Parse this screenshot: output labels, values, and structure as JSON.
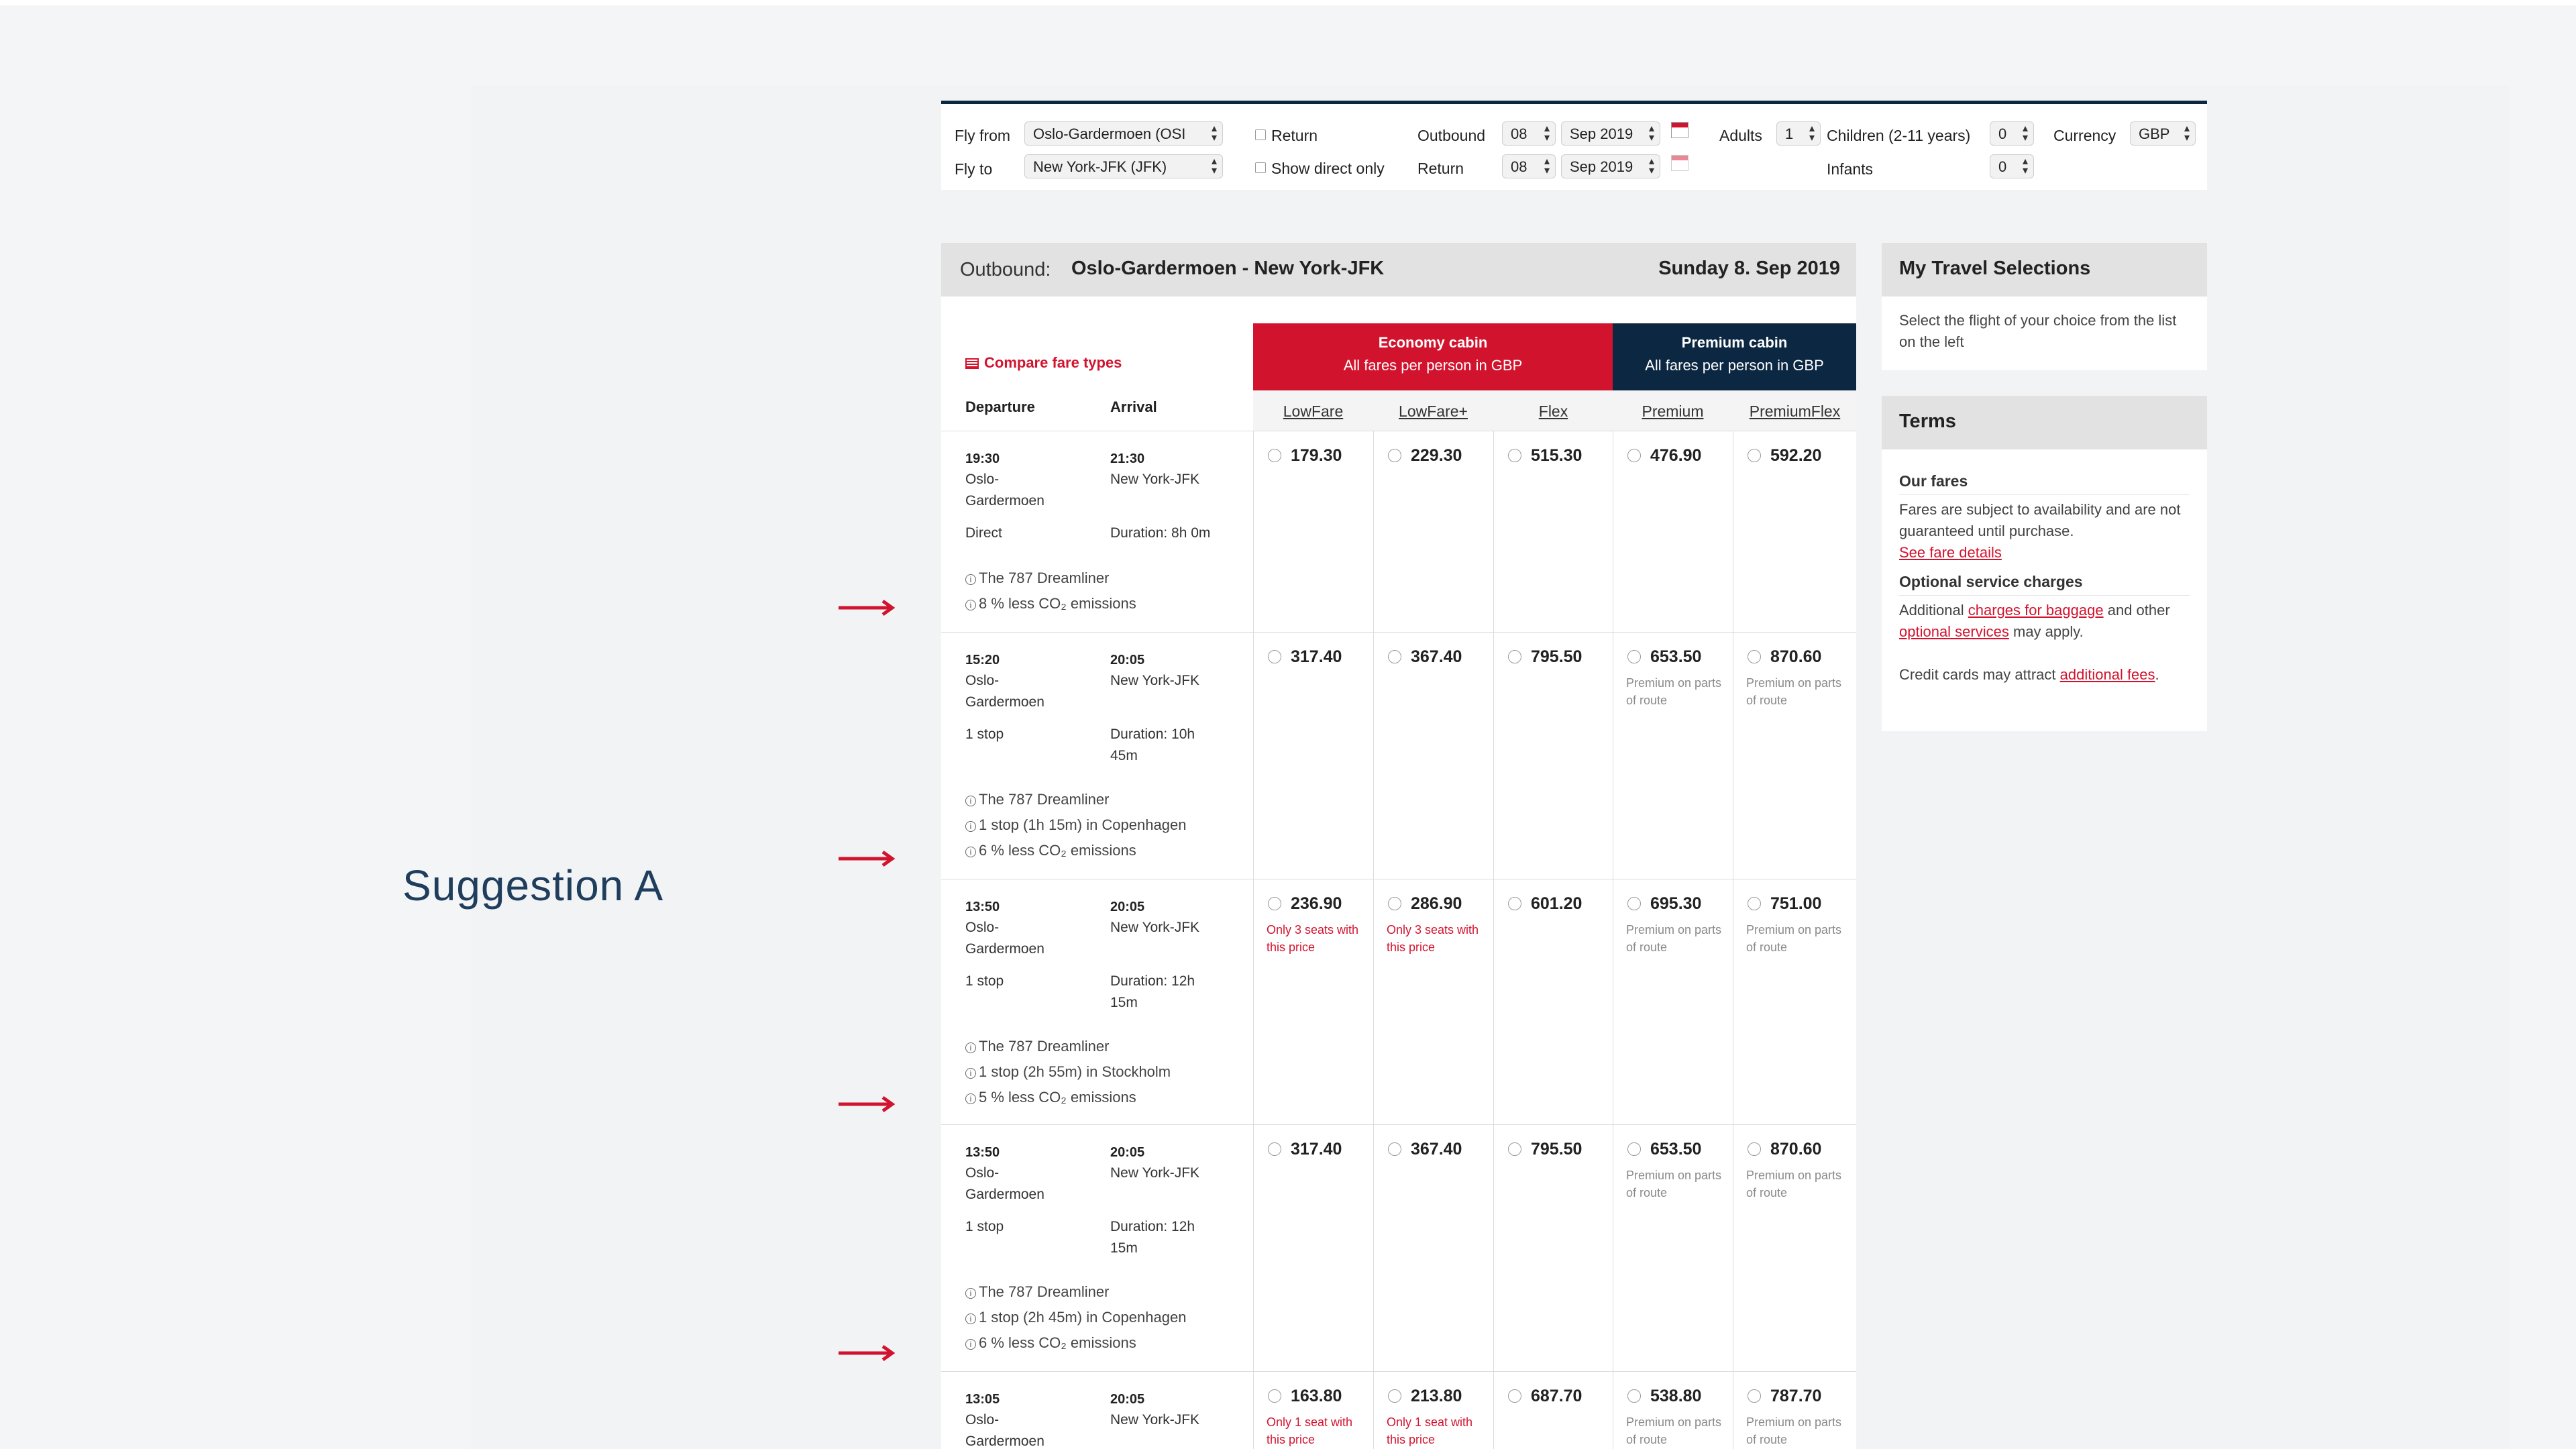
{
  "label": "Suggestion A",
  "search": {
    "fly_from_label": "Fly from",
    "fly_from_value": "Oslo-Gardermoen (OSI",
    "fly_to_label": "Fly to",
    "fly_to_value": "New York-JFK (JFK)",
    "return_label": "Return",
    "direct_label": "Show direct only",
    "outbound_label": "Outbound",
    "outbound_day": "08",
    "outbound_month": "Sep 2019",
    "return_date_label": "Return",
    "return_day": "08",
    "return_month": "Sep 2019",
    "adults_label": "Adults",
    "adults_value": "1",
    "children_label": "Children (2-11 years)",
    "children_value": "0",
    "infants_label": "Infants",
    "infants_value": "0",
    "currency_label": "Currency",
    "currency_value": "GBP"
  },
  "outbound": {
    "prefix": "Outbound:",
    "route": "Oslo-Gardermoen - New York-JFK",
    "date": "Sunday 8. Sep 2019"
  },
  "table": {
    "compare_label": "Compare fare types",
    "departure_header": "Departure",
    "arrival_header": "Arrival",
    "economy_title": "Economy cabin",
    "economy_sub": "All fares per person in GBP",
    "premium_title": "Premium cabin",
    "premium_sub": "All fares per person in GBP",
    "fare_types": [
      "LowFare",
      "LowFare+",
      "Flex",
      "Premium",
      "PremiumFlex"
    ]
  },
  "flights": [
    {
      "dep_time": "19:30",
      "dep_city_1": "Oslo-",
      "dep_city_2": "Gardermoen",
      "arr_time": "21:30",
      "arr_city": "New York-JFK",
      "stops": "Direct",
      "duration_1": "Duration: 8h 0m",
      "duration_2": "",
      "aircraft": "The 787 Dreamliner",
      "stop_detail": "",
      "co2": "8 % less CO₂ emissions",
      "prices": [
        "179.30",
        "229.30",
        "515.30",
        "476.90",
        "592.20"
      ],
      "notes": [
        "",
        "",
        "",
        "",
        ""
      ]
    },
    {
      "dep_time": "15:20",
      "dep_city_1": "Oslo-",
      "dep_city_2": "Gardermoen",
      "arr_time": "20:05",
      "arr_city": "New York-JFK",
      "stops": "1 stop",
      "duration_1": "Duration: 10h",
      "duration_2": "45m",
      "aircraft": "The 787 Dreamliner",
      "stop_detail": "1 stop (1h 15m) in Copenhagen",
      "co2": "6 % less CO₂ emissions",
      "prices": [
        "317.40",
        "367.40",
        "795.50",
        "653.50",
        "870.60"
      ],
      "notes": [
        "",
        "",
        "",
        "Premium on parts of route",
        "Premium on parts of route"
      ]
    },
    {
      "dep_time": "13:50",
      "dep_city_1": "Oslo-",
      "dep_city_2": "Gardermoen",
      "arr_time": "20:05",
      "arr_city": "New York-JFK",
      "stops": "1 stop",
      "duration_1": "Duration: 12h",
      "duration_2": "15m",
      "aircraft": "The 787 Dreamliner",
      "stop_detail": "1 stop (2h 55m) in Stockholm",
      "co2": "5 % less CO₂ emissions",
      "prices": [
        "236.90",
        "286.90",
        "601.20",
        "695.30",
        "751.00"
      ],
      "notes": [
        "Only 3 seats with this price",
        "Only 3 seats with this price",
        "",
        "Premium on parts of route",
        "Premium on parts of route"
      ]
    },
    {
      "dep_time": "13:50",
      "dep_city_1": "Oslo-",
      "dep_city_2": "Gardermoen",
      "arr_time": "20:05",
      "arr_city": "New York-JFK",
      "stops": "1 stop",
      "duration_1": "Duration: 12h",
      "duration_2": "15m",
      "aircraft": "The 787 Dreamliner",
      "stop_detail": "1 stop (2h 45m) in Copenhagen",
      "co2": "6 % less CO₂ emissions",
      "prices": [
        "317.40",
        "367.40",
        "795.50",
        "653.50",
        "870.60"
      ],
      "notes": [
        "",
        "",
        "",
        "Premium on parts of route",
        "Premium on parts of route"
      ]
    },
    {
      "dep_time": "13:05",
      "dep_city_1": "Oslo-",
      "dep_city_2": "Gardermoen",
      "arr_time": "20:05",
      "arr_city": "New York-JFK",
      "stops": "",
      "duration_1": "",
      "duration_2": "",
      "aircraft": "",
      "stop_detail": "",
      "co2": "",
      "prices": [
        "163.80",
        "213.80",
        "687.70",
        "538.80",
        "787.70"
      ],
      "notes": [
        "Only 1 seat with this price",
        "Only 1 seat with this price",
        "",
        "Premium on parts of route",
        "Premium on parts of route"
      ]
    }
  ],
  "side": {
    "selections_title": "My Travel Selections",
    "selections_text": "Select the flight of your choice from the list on the left",
    "terms_title": "Terms",
    "our_fares_title": "Our fares",
    "our_fares_text": "Fares are subject to availability and are not guaranteed until purchase.",
    "see_fare_link": "See fare details",
    "optional_title": "Optional service charges",
    "additional_text": "Additional",
    "baggage_link": "charges for baggage",
    "and_other_text": "and other",
    "optional_link": "optional services",
    "may_apply_text": "may apply.",
    "credit_text": "Credit cards may attract",
    "fees_link": "additional fees",
    "period": "."
  },
  "colors": {
    "brand_red": "#d2132e",
    "navy": "#0b2742",
    "text_navy": "#1f3d5c"
  }
}
